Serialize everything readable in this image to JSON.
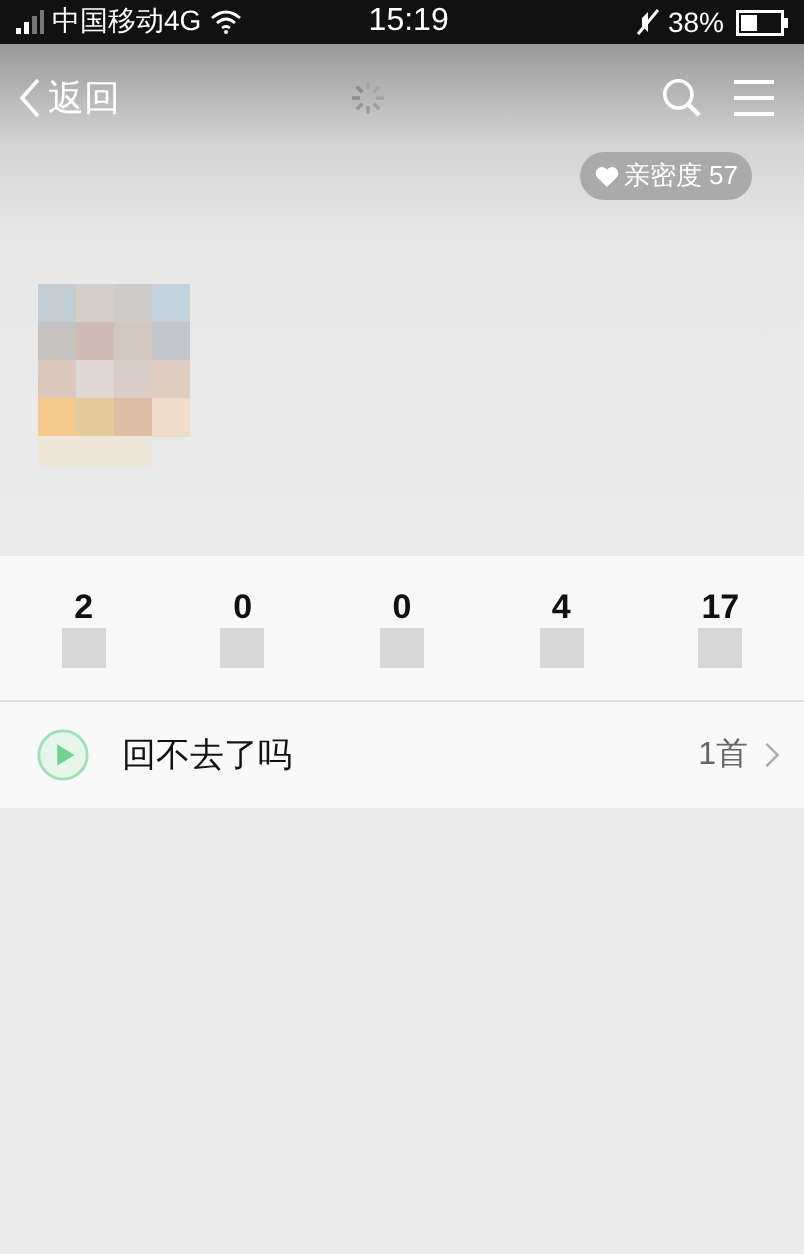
{
  "status_bar": {
    "carrier": "中国移动4G",
    "time": "15:19",
    "battery": "38%"
  },
  "nav": {
    "back_label": "返回"
  },
  "intimacy_badge": {
    "label": "亲密度 57"
  },
  "stats": [
    {
      "value": "2"
    },
    {
      "value": "0"
    },
    {
      "value": "0"
    },
    {
      "value": "4"
    },
    {
      "value": "17"
    }
  ],
  "playlist_row": {
    "title": "回不去了吗",
    "count": "1首"
  }
}
